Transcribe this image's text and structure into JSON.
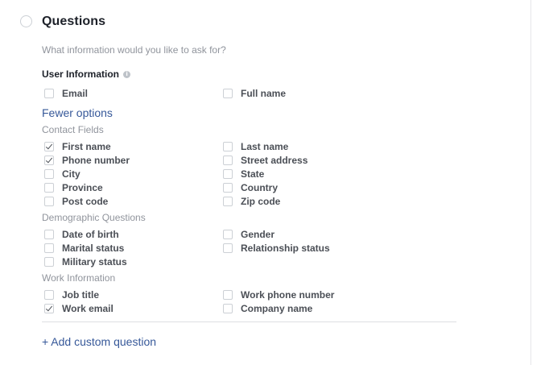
{
  "section": {
    "title": "Questions",
    "subtitle": "What information would you like to ask for?"
  },
  "user_information": {
    "heading": "User Information",
    "info_icon": "info-icon",
    "options": [
      {
        "label": "Email",
        "checked": false
      },
      {
        "label": "Full name",
        "checked": false
      }
    ]
  },
  "fewer_options_label": "Fewer options",
  "contact_fields": {
    "label": "Contact Fields",
    "options": [
      {
        "label": "First name",
        "checked": true
      },
      {
        "label": "Last name",
        "checked": false
      },
      {
        "label": "Phone number",
        "checked": true
      },
      {
        "label": "Street address",
        "checked": false
      },
      {
        "label": "City",
        "checked": false
      },
      {
        "label": "State",
        "checked": false
      },
      {
        "label": "Province",
        "checked": false
      },
      {
        "label": "Country",
        "checked": false
      },
      {
        "label": "Post code",
        "checked": false
      },
      {
        "label": "Zip code",
        "checked": false
      }
    ]
  },
  "demographic_questions": {
    "label": "Demographic Questions",
    "options": [
      {
        "label": "Date of birth",
        "checked": false
      },
      {
        "label": "Gender",
        "checked": false
      },
      {
        "label": "Marital status",
        "checked": false
      },
      {
        "label": "Relationship status",
        "checked": false
      },
      {
        "label": "Military status",
        "checked": false
      }
    ]
  },
  "work_information": {
    "label": "Work Information",
    "options": [
      {
        "label": "Job title",
        "checked": false
      },
      {
        "label": "Work phone number",
        "checked": false
      },
      {
        "label": "Work email",
        "checked": true
      },
      {
        "label": "Company name",
        "checked": false
      }
    ]
  },
  "add_custom_question_label": "+ Add custom question",
  "colors": {
    "link": "#365899",
    "text": "#4b4f56",
    "muted": "#90949c",
    "border": "#ccd0d5"
  }
}
